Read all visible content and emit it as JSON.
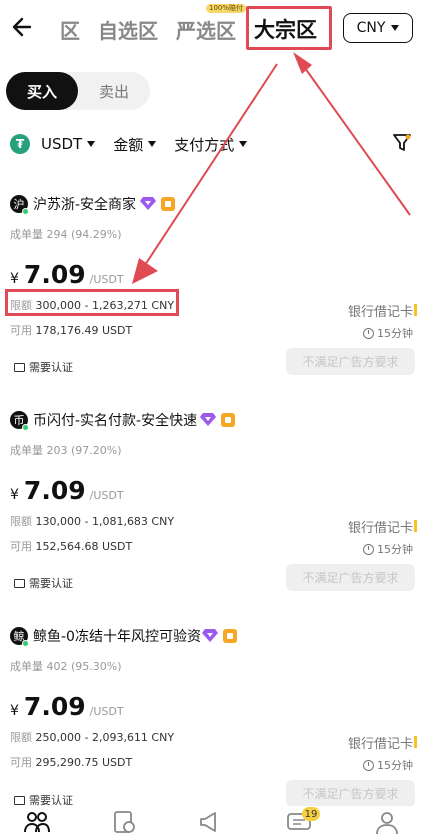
{
  "header": {
    "back_icon": "arrow-left-icon",
    "tabs": [
      {
        "label": "区",
        "state": "partial"
      },
      {
        "label": "自选区",
        "state": "inactive"
      },
      {
        "label": "严选区",
        "state": "inactive",
        "badge": "100%赔付"
      },
      {
        "label": "大宗区",
        "state": "active"
      }
    ],
    "currency": "CNY"
  },
  "trade_switch": {
    "buy": "买入",
    "sell": "卖出"
  },
  "filters": {
    "coin": "USDT",
    "coin_icon": "tether-icon",
    "amount": "金额",
    "payment": "支付方式",
    "filter_icon": "funnel-icon"
  },
  "listings": [
    {
      "avatar": "沪",
      "merchant": "沪苏浙-安全商家",
      "orders_label": "成单量",
      "orders": "294 (94.29%)",
      "currency_symbol": "¥",
      "price": "7.09",
      "unit": "/USDT",
      "limit_label": "限额",
      "limit": "300,000 - 1,263,271 CNY",
      "available_label": "可用",
      "available": "178,176.49 USDT",
      "payment": "银行借记卡",
      "time": "15分钟",
      "verify": "需要认证",
      "button": "不满足广告方要求"
    },
    {
      "avatar": "币",
      "merchant": "币闪付-实名付款-安全快速",
      "orders_label": "成单量",
      "orders": "203 (97.20%)",
      "currency_symbol": "¥",
      "price": "7.09",
      "unit": "/USDT",
      "limit_label": "限额",
      "limit": "130,000 - 1,081,683 CNY",
      "available_label": "可用",
      "available": "152,564.68 USDT",
      "payment": "银行借记卡",
      "time": "15分钟",
      "verify": "需要认证",
      "button": "不满足广告方要求"
    },
    {
      "avatar": "鲸",
      "merchant": "鲸鱼-0冻结十年风控可验资",
      "orders_label": "成单量",
      "orders": "402 (95.30%)",
      "currency_symbol": "¥",
      "price": "7.09",
      "unit": "/USDT",
      "limit_label": "限额",
      "limit": "250,000 - 2,093,611 CNY",
      "available_label": "可用",
      "available": "295,290.75 USDT",
      "payment": "银行借记卡",
      "time": "15分钟",
      "verify": "需要认证",
      "button": "不满足广告方要求"
    }
  ],
  "bottom_nav": {
    "items": [
      "p2p-icon",
      "orders-icon",
      "ads-icon",
      "chat-icon",
      "profile-icon"
    ],
    "chat_badge": "19"
  },
  "annotation": {
    "color": "#e04a54"
  }
}
